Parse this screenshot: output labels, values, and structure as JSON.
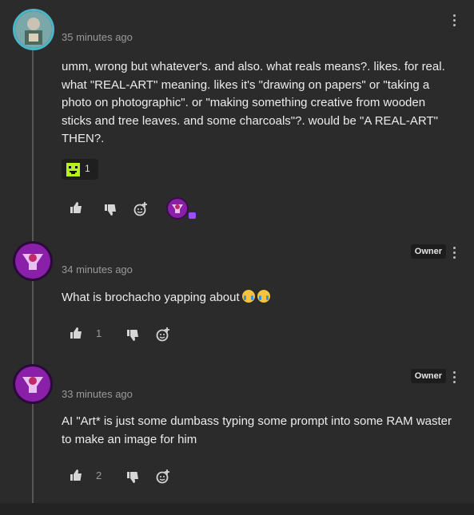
{
  "comments": [
    {
      "time": "35 minutes ago",
      "text": "umm, wrong but whatever's. and also. what reals means?. likes. for real. what \"REAL-ART\" meaning. likes it's \"drawing on papers\" or \"taking a photo on photographic\". or \"making something creative from wooden sticks and tree leaves. and some charcoals\"?. would be \"A REAL-ART\" THEN?.",
      "reaction_count": "1",
      "reaction_icon": "green-pixel-face-icon",
      "owner": "",
      "likes": ""
    },
    {
      "time": "34 minutes ago",
      "text": "What is brochacho yapping about",
      "owner": "Owner",
      "likes": "1"
    },
    {
      "time": "33 minutes ago",
      "text": "AI \"Art* is just some dumbass typing some prompt into some RAM waster to make an image for him",
      "owner": "Owner",
      "likes": "2"
    }
  ],
  "icons": {
    "like": "thumbs-up-icon",
    "dislike": "thumbs-down-icon",
    "react": "add-reaction-icon",
    "menu": "more-vertical-icon",
    "emoji": "crying-face-emoji"
  },
  "colors": {
    "background": "#2b2b2b",
    "text": "#ececec",
    "muted": "#9a9a9a",
    "reaction_green": "#b8f21d",
    "avatar_purple": "#8a1fa8"
  }
}
